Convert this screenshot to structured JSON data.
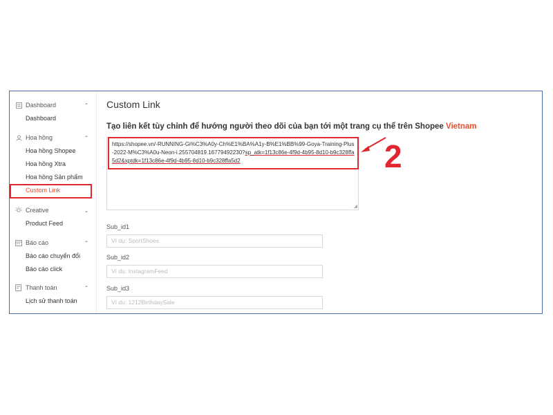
{
  "colors": {
    "accent": "#ee4d2d",
    "annotation": "#e0262e",
    "frame_border": "#4a6aa8"
  },
  "sidebar": {
    "groups": [
      {
        "label": "Dashboard",
        "icon": "dashboard-icon",
        "items": [
          {
            "label": "Dashboard"
          }
        ]
      },
      {
        "label": "Hoa hồng",
        "icon": "user-icon",
        "items": [
          {
            "label": "Hoa hồng Shopee"
          },
          {
            "label": "Hoa hồng Xtra"
          },
          {
            "label": "Hoa hồng Sản phẩm"
          },
          {
            "label": "Custom Link",
            "active": true
          }
        ]
      },
      {
        "label": "Creative",
        "icon": "lightbulb-icon",
        "items": [
          {
            "label": "Product Feed"
          }
        ]
      },
      {
        "label": "Báo cáo",
        "icon": "calendar-icon",
        "items": [
          {
            "label": "Báo cáo chuyển đổi"
          },
          {
            "label": "Báo cáo click"
          }
        ]
      },
      {
        "label": "Thanh toán",
        "icon": "wallet-icon",
        "items": [
          {
            "label": "Lịch sử thanh toán"
          }
        ]
      }
    ]
  },
  "main": {
    "title": "Custom Link",
    "description": "Tạo liên kết tùy chỉnh để hướng người theo dõi của bạn tới một trang cụ thể trên Shopee",
    "description_highlight": "Vietnam",
    "url_text_plain": "https://shopee.vn/-RUNNING-Gi%C3%A0y-Ch%E1%BA%A1y-B%E1%BB%99-Goya-Training-Plus-2022-M%C3%A0u-Neon-i.255704819.16779492230?",
    "url_text_underlined": "sp_atk=1f13c86e-4f9d-4b95-8d10-b9c328ffa5d2&xptdk=1f13c86e-4f9d-4b95-8d10-b9c328ffa5d2",
    "fields": [
      {
        "label": "Sub_id1",
        "placeholder": "Ví dụ: SportShoes"
      },
      {
        "label": "Sub_id2",
        "placeholder": "Ví dụ: InstagramFeed"
      },
      {
        "label": "Sub_id3",
        "placeholder": "Ví dụ: 1212BirthdaySale"
      }
    ]
  },
  "annotation": {
    "number": "2"
  }
}
